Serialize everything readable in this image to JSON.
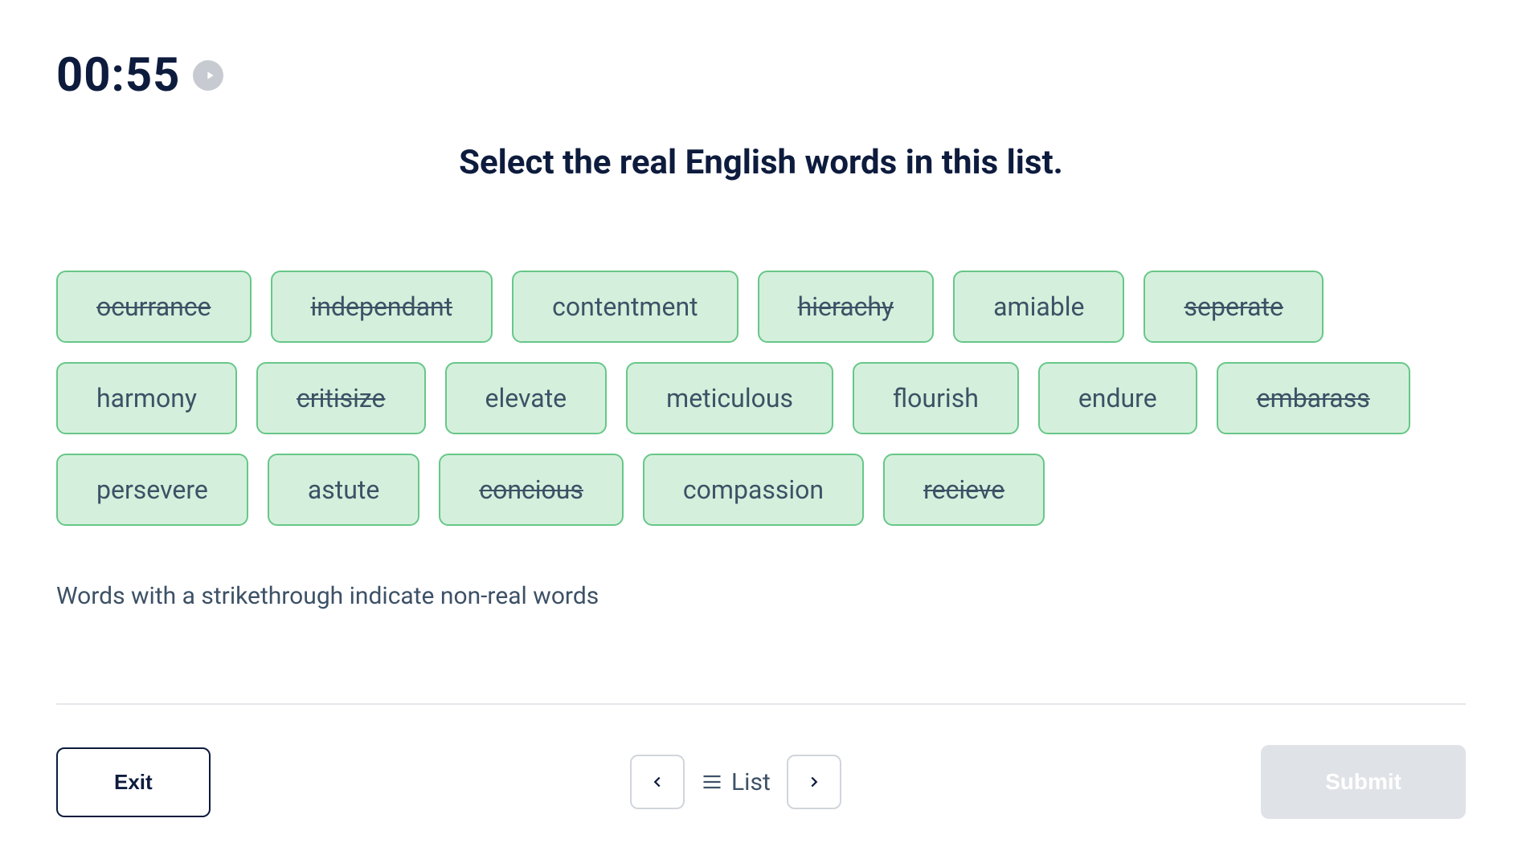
{
  "timer": "00:55",
  "question": "Select the real English words in this list.",
  "words": [
    {
      "text": "ocurrance",
      "strike": true
    },
    {
      "text": "independant",
      "strike": true
    },
    {
      "text": "contentment",
      "strike": false
    },
    {
      "text": "hierachy",
      "strike": true
    },
    {
      "text": "amiable",
      "strike": false
    },
    {
      "text": "seperate",
      "strike": true
    },
    {
      "text": "harmony",
      "strike": false
    },
    {
      "text": "critisize",
      "strike": true
    },
    {
      "text": "elevate",
      "strike": false
    },
    {
      "text": "meticulous",
      "strike": false
    },
    {
      "text": "flourish",
      "strike": false
    },
    {
      "text": "endure",
      "strike": false
    },
    {
      "text": "embarass",
      "strike": true
    },
    {
      "text": "persevere",
      "strike": false
    },
    {
      "text": "astute",
      "strike": false
    },
    {
      "text": "concious",
      "strike": true
    },
    {
      "text": "compassion",
      "strike": false
    },
    {
      "text": "recieve",
      "strike": true
    }
  ],
  "hint": "Words with a strikethrough indicate non-real words",
  "footer": {
    "exit": "Exit",
    "list": "List",
    "submit": "Submit"
  }
}
